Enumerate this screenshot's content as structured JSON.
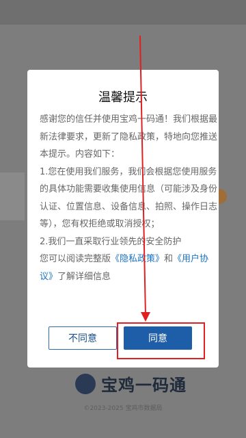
{
  "dialog": {
    "title": "温馨提示",
    "paragraph1": "感谢您的信任并使用宝鸡一码通！我们根据最新法律要求，更新了隐私政策，特地向您推送本提示。内容如下：",
    "paragraph2": "1.您在使用我们服务，我们会根据您使用服务的具体功能需要收集使用信息（可能涉及身份认证、位置信息、设备信息、拍照、操作日志等），您有权拒绝或取消授权；",
    "paragraph3": "2.我们一直采取行业领先的安全防护",
    "paragraph4_pre": "您可以阅读完整版",
    "privacy_link": "《隐私政策》",
    "paragraph4_mid": "和",
    "terms_link": "《用户协议》",
    "paragraph4_post": "了解详细信息",
    "disagree_label": "不同意",
    "agree_label": "同意"
  },
  "background": {
    "app_name": "宝鸡一码通",
    "copyright": "©2023-2025 宝鸡市数据局"
  },
  "colors": {
    "primary": "#1e5da8",
    "link": "#1a73c6",
    "annotation": "#e02020"
  }
}
